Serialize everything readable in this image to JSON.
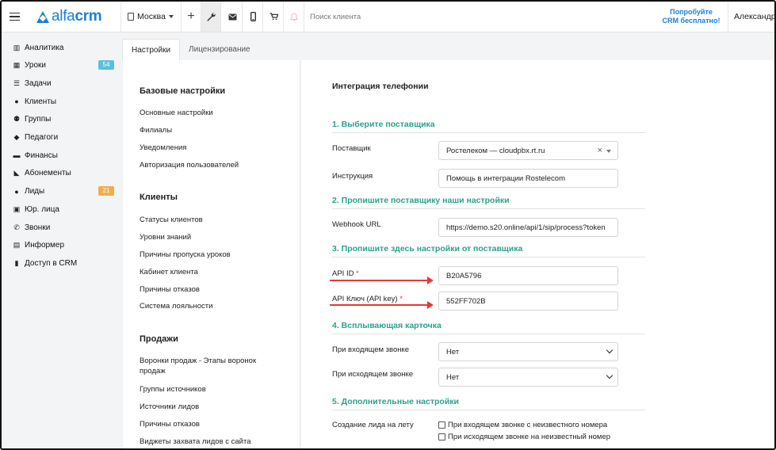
{
  "header": {
    "logo_prefix": "alfa",
    "logo_suffix": "crm",
    "city": "Москва",
    "search_placeholder": "Поиск клиента",
    "promo_line1": "Попробуйте",
    "promo_line2": "CRM бесплатно!",
    "user_name": "Александр"
  },
  "icons": {
    "menu": "hamburger-icon",
    "building": "building-icon",
    "plus": "plus-icon",
    "wrench": "wrench-icon",
    "mail": "mail-icon",
    "phone": "mobile-icon",
    "cart": "cart-icon",
    "bell": "bell-icon"
  },
  "sidebar": {
    "items": [
      {
        "label": "Аналитика",
        "icon": "analytics-icon",
        "glyph": "▥"
      },
      {
        "label": "Уроки",
        "icon": "calendar-icon",
        "glyph": "▦",
        "badge": "54",
        "badge_color": "#5bc0de"
      },
      {
        "label": "Задачи",
        "icon": "tasks-icon",
        "glyph": "☰"
      },
      {
        "label": "Клиенты",
        "icon": "user-icon",
        "glyph": "●"
      },
      {
        "label": "Группы",
        "icon": "group-icon",
        "glyph": "⚉"
      },
      {
        "label": "Педагоги",
        "icon": "graduation-cap-icon",
        "glyph": "◆"
      },
      {
        "label": "Финансы",
        "icon": "finance-icon",
        "glyph": "▬"
      },
      {
        "label": "Абонементы",
        "icon": "tag-icon",
        "glyph": "◣"
      },
      {
        "label": "Лиды",
        "icon": "user-plus-icon",
        "glyph": "●",
        "badge": "21",
        "badge_color": "#f0ad4e"
      },
      {
        "label": "Юр. лица",
        "icon": "briefcase-icon",
        "glyph": "▣"
      },
      {
        "label": "Звонки",
        "icon": "phone-icon",
        "glyph": "✆"
      },
      {
        "label": "Информер",
        "icon": "informer-icon",
        "glyph": "▤"
      },
      {
        "label": "Доступ в CRM",
        "icon": "lock-icon",
        "glyph": "▮"
      }
    ]
  },
  "tabs": [
    {
      "label": "Настройки",
      "active": true
    },
    {
      "label": "Лицензирование",
      "active": false
    }
  ],
  "settings_nav": {
    "groups": [
      {
        "title": "Базовые настройки",
        "links": [
          "Основные настройки",
          "Филиалы",
          "Уведомления",
          "Авторизация пользователей"
        ]
      },
      {
        "title": "Клиенты",
        "links": [
          "Статусы клиентов",
          "Уровни знаний",
          "Причины пропуска уроков",
          "Кабинет клиента",
          "Причины отказов",
          "Система лояльности"
        ]
      },
      {
        "title": "Продажи",
        "links": [
          "Воронки продаж - Этапы воронок продаж",
          "Группы источников",
          "Источники лидов",
          "Причины отказов",
          "Виджеты захвата лидов с сайта"
        ]
      }
    ]
  },
  "main": {
    "title": "Интеграция телефонии",
    "section1": "1. Выберите поставщика",
    "provider_label": "Поставщик",
    "provider_value": "Ростелеком — cloudpbx.rt.ru",
    "instruction_label": "Инструкция",
    "instruction_value": "Помощь в интеграции Rostelecom",
    "section2": "2. Пропишите поставщику наши настройки",
    "webhook_label": "Webhook URL",
    "webhook_value": "https://demo.s20.online/api/1/sip/process?token",
    "section3": "3. Пропишите здесь настройки от поставщика",
    "api_id_label": "API ID",
    "api_id_value": "B20A5796",
    "api_key_label": "API Ключ (API key)",
    "api_key_value": "552FF702B",
    "required_mark": "*",
    "section4": "4. Всплывающая карточка",
    "incoming_label": "При входящем звонке",
    "incoming_value": "Нет",
    "outgoing_label": "При исходящем звонке",
    "outgoing_value": "Нет",
    "section5": "5. Дополнительные настройки",
    "create_lead_label": "Создание лида на лету",
    "check_incoming": "При входящем звонке с неизвестного номера",
    "check_outgoing": "При исходящем звонке на неизвестный номер"
  },
  "colors": {
    "brand": "#1b7fd9",
    "section": "#2aa18a",
    "annotation": "#e53935"
  }
}
